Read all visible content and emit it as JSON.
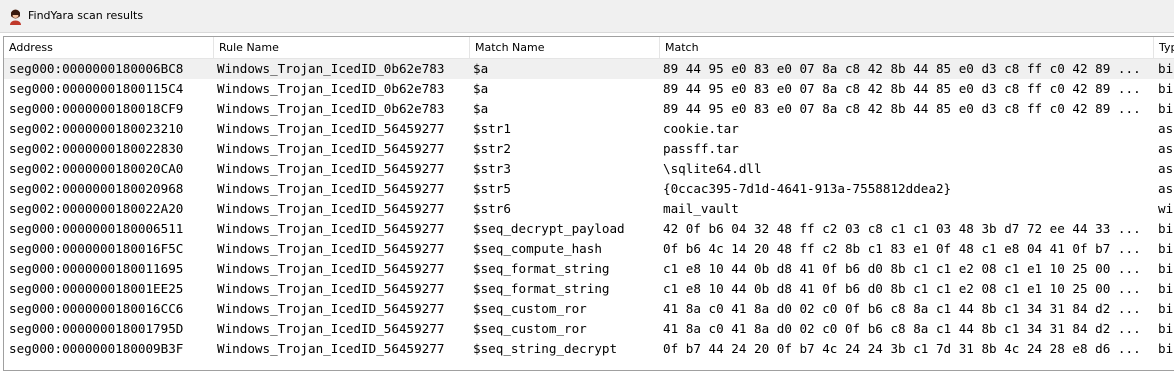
{
  "window": {
    "title": "FindYara scan results",
    "icon": "findyara-app-icon"
  },
  "table": {
    "columns": [
      "Address",
      "Rule Name",
      "Match Name",
      "Match",
      "Typ"
    ],
    "rows": [
      [
        "seg000:0000000180006BC8",
        "Windows_Trojan_IcedID_0b62e783",
        "$a",
        "89 44 95 e0 83 e0 07 8a c8 42 8b 44 85 e0 d3 c8 ff c0 42 89 ...",
        "bi"
      ],
      [
        "seg000:00000001800115C4",
        "Windows_Trojan_IcedID_0b62e783",
        "$a",
        "89 44 95 e0 83 e0 07 8a c8 42 8b 44 85 e0 d3 c8 ff c0 42 89 ...",
        "bi"
      ],
      [
        "seg000:0000000180018CF9",
        "Windows_Trojan_IcedID_0b62e783",
        "$a",
        "89 44 95 e0 83 e0 07 8a c8 42 8b 44 85 e0 d3 c8 ff c0 42 89 ...",
        "bi"
      ],
      [
        "seg002:0000000180023210",
        "Windows_Trojan_IcedID_56459277",
        "$str1",
        "cookie.tar",
        "as"
      ],
      [
        "seg002:0000000180022830",
        "Windows_Trojan_IcedID_56459277",
        "$str2",
        "passff.tar",
        "as"
      ],
      [
        "seg002:0000000180020CA0",
        "Windows_Trojan_IcedID_56459277",
        "$str3",
        "\\sqlite64.dll",
        "as"
      ],
      [
        "seg002:0000000180020968",
        "Windows_Trojan_IcedID_56459277",
        "$str5",
        "{0ccac395-7d1d-4641-913a-7558812ddea2}",
        "as"
      ],
      [
        "seg002:0000000180022A20",
        "Windows_Trojan_IcedID_56459277",
        "$str6",
        "mail_vault",
        "wi"
      ],
      [
        "seg000:0000000180006511",
        "Windows_Trojan_IcedID_56459277",
        "$seq_decrypt_payload",
        "42 0f b6 04 32 48 ff c2 03 c8 c1 c1 03 48 3b d7 72 ee 44 33 ...",
        "bi"
      ],
      [
        "seg000:0000000180016F5C",
        "Windows_Trojan_IcedID_56459277",
        "$seq_compute_hash",
        "0f b6 4c 14 20 48 ff c2 8b c1 83 e1 0f 48 c1 e8 04 41 0f b7 ...",
        "bi"
      ],
      [
        "seg000:0000000180011695",
        "Windows_Trojan_IcedID_56459277",
        "$seq_format_string",
        "c1 e8 10 44 0b d8 41 0f b6 d0 8b c1 c1 e2 08 c1 e1 10 25 00 ...",
        "bi"
      ],
      [
        "seg000:000000018001EE25",
        "Windows_Trojan_IcedID_56459277",
        "$seq_format_string",
        "c1 e8 10 44 0b d8 41 0f b6 d0 8b c1 c1 e2 08 c1 e1 10 25 00 ...",
        "bi"
      ],
      [
        "seg000:0000000180016CC6",
        "Windows_Trojan_IcedID_56459277",
        "$seq_custom_ror",
        "41 8a c0 41 8a d0 02 c0 0f b6 c8 8a c1 44 8b c1 34 31 84 d2 ...",
        "bi"
      ],
      [
        "seg000:000000018001795D",
        "Windows_Trojan_IcedID_56459277",
        "$seq_custom_ror",
        "41 8a c0 41 8a d0 02 c0 0f b6 c8 8a c1 44 8b c1 34 31 84 d2 ...",
        "bi"
      ],
      [
        "seg000:0000000180009B3F",
        "Windows_Trojan_IcedID_56459277",
        "$seq_string_decrypt",
        "0f b7 44 24 20 0f b7 4c 24 24 3b c1 7d 31 8b 4c 24 28 e8 d6 ...",
        "bi"
      ]
    ],
    "selected_row": 0
  },
  "colors": {
    "selected_row_bg": "#f0f0f0",
    "titlebar_bg": "#f0f0f0"
  }
}
